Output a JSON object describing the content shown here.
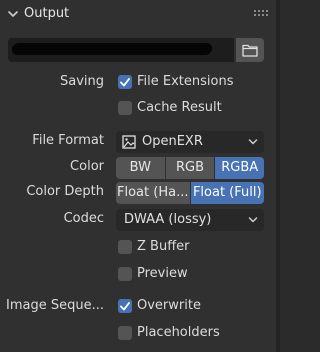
{
  "panel": {
    "title": "Output"
  },
  "path": {
    "value": ""
  },
  "saving": {
    "label": "Saving",
    "file_extensions": {
      "label": "File Extensions",
      "checked": true
    },
    "cache_result": {
      "label": "Cache Result",
      "checked": false
    }
  },
  "file_format": {
    "label": "File Format",
    "value": "OpenEXR"
  },
  "color": {
    "label": "Color",
    "options": [
      "BW",
      "RGB",
      "RGBA"
    ],
    "selected": "RGBA"
  },
  "color_depth": {
    "label": "Color Depth",
    "options": [
      "Float (Ha...",
      "Float (Full)"
    ],
    "selected": "Float (Full)"
  },
  "codec": {
    "label": "Codec",
    "value": "DWAA (lossy)"
  },
  "z_buffer": {
    "label": "Z Buffer",
    "checked": false
  },
  "preview": {
    "label": "Preview",
    "checked": false
  },
  "image_sequence": {
    "label": "Image Seque...",
    "overwrite": {
      "label": "Overwrite",
      "checked": true
    },
    "placeholders": {
      "label": "Placeholders",
      "checked": false
    }
  },
  "colors": {
    "accent": "#4772b3",
    "panel": "#303030",
    "field": "#282828",
    "button": "#545454"
  }
}
